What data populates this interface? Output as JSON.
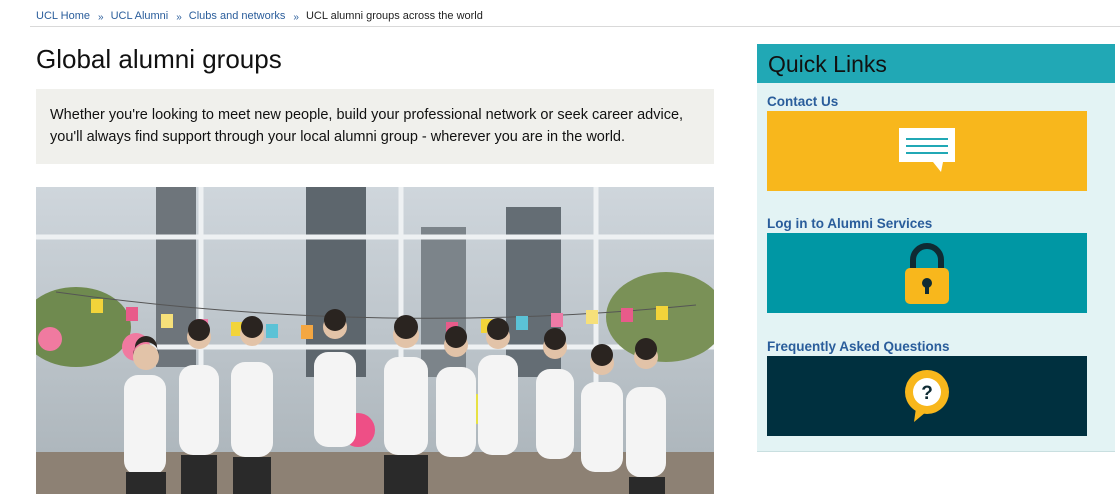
{
  "breadcrumb": {
    "items": [
      "UCL Home",
      "UCL Alumni",
      "Clubs and networks"
    ],
    "separator": "»",
    "current": "UCL alumni groups across the world"
  },
  "page": {
    "title": "Global alumni groups",
    "intro": "Whether you're looking to meet new people, build your professional network or seek career advice, you'll always find support through your local alumni group - wherever you are in the world."
  },
  "hero": {
    "icon": "group-photo-image"
  },
  "quick_links": {
    "heading": "Quick Links",
    "items": [
      {
        "label": "Contact Us",
        "icon": "speech-bubble-icon",
        "color": "#f8b71c"
      },
      {
        "label": "Log in to Alumni Services",
        "icon": "padlock-icon",
        "color": "#0097a4"
      },
      {
        "label": "Frequently Asked Questions",
        "icon": "question-bubble-icon",
        "color": "#00303f"
      }
    ]
  },
  "colors": {
    "link": "#2a5d9b",
    "quick_links_header": "#21a8b5",
    "quick_links_bg": "#e3f3f4",
    "intro_bg": "#f0f0ec"
  }
}
